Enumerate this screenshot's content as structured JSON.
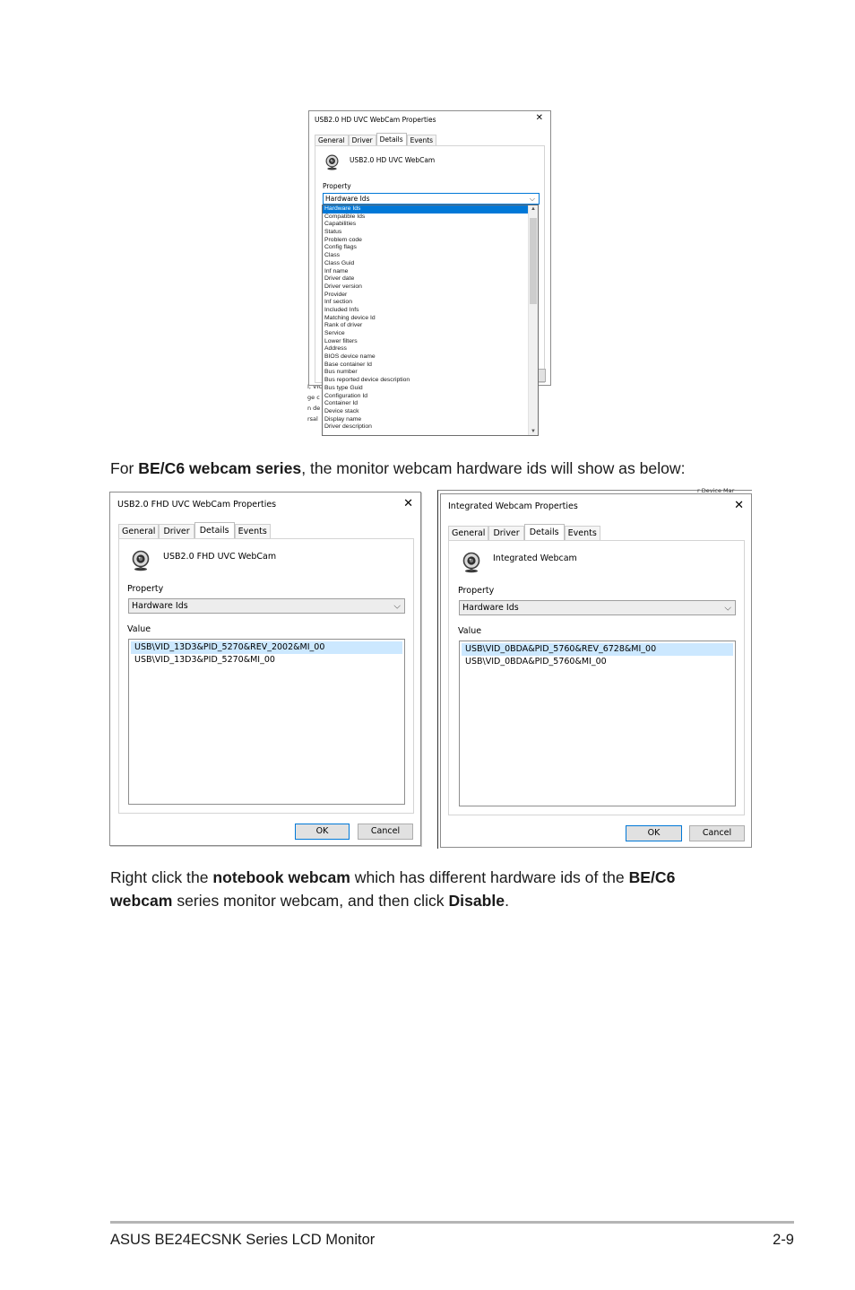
{
  "dialog_top": {
    "title": "USB2.0 HD UVC WebCam Properties",
    "close": "✕",
    "tabs": [
      "General",
      "Driver",
      "Details",
      "Events"
    ],
    "device_name": "USB2.0 HD UVC WebCam",
    "property_label": "Property",
    "property_value": "Hardware Ids",
    "dropdown_items": [
      "Hardware Ids",
      "Compatible Ids",
      "Capabilities",
      "Status",
      "Problem code",
      "Config flags",
      "Class",
      "Class Guid",
      "Inf name",
      "Driver date",
      "Driver version",
      "Provider",
      "Inf section",
      "Included Infs",
      "Matching device Id",
      "Rank of driver",
      "Service",
      "Lower filters",
      "Address",
      "BIOS device name",
      "Base container Id",
      "Bus number",
      "Bus reported device description",
      "Bus type Guid",
      "Configuration Id",
      "Container Id",
      "Device stack",
      "Display name",
      "Driver description"
    ],
    "behind_fragments": [
      "I, VIC",
      "ge c",
      "n de",
      "rsal S"
    ]
  },
  "para1": {
    "prefix": "For ",
    "bold": "BE/C6 webcam series",
    "suffix": ", the monitor webcam hardware ids will show as below:"
  },
  "dialog_left": {
    "title": "USB2.0 FHD UVC WebCam Properties",
    "close": "✕",
    "tabs": [
      "General",
      "Driver",
      "Details",
      "Events"
    ],
    "device_name": "USB2.0 FHD UVC WebCam",
    "property_label": "Property",
    "property_value": "Hardware Ids",
    "value_label": "Value",
    "values": [
      "USB\\VID_13D3&PID_5270&REV_2002&MI_00",
      "USB\\VID_13D3&PID_5270&MI_00"
    ],
    "ok": "OK",
    "cancel": "Cancel"
  },
  "dialog_right": {
    "title": "Integrated Webcam Properties",
    "close": "✕",
    "tabs": [
      "General",
      "Driver",
      "Details",
      "Events"
    ],
    "device_name": "Integrated Webcam",
    "property_label": "Property",
    "property_value": "Hardware Ids",
    "value_label": "Value",
    "values": [
      "USB\\VID_0BDA&PID_5760&REV_6728&MI_00",
      "USB\\VID_0BDA&PID_5760&MI_00"
    ],
    "ok": "OK",
    "cancel": "Cancel",
    "behind_fragment": "r Device Mar"
  },
  "para2": {
    "t1": "Right click the ",
    "b1": "notebook webcam",
    "t2": " which has different hardware ids of the ",
    "b2": "BE/C6",
    "b3": "webcam",
    "t3": " series monitor webcam, and then click ",
    "b4": "Disable",
    "t4": "."
  },
  "footer": {
    "left": "ASUS BE24ECSNK Series LCD Monitor",
    "right": "2-9"
  },
  "colors": {
    "selection_blue": "#0078d7",
    "value_highlight": "#cce8ff",
    "footer_rule": "#b5b5b5"
  }
}
